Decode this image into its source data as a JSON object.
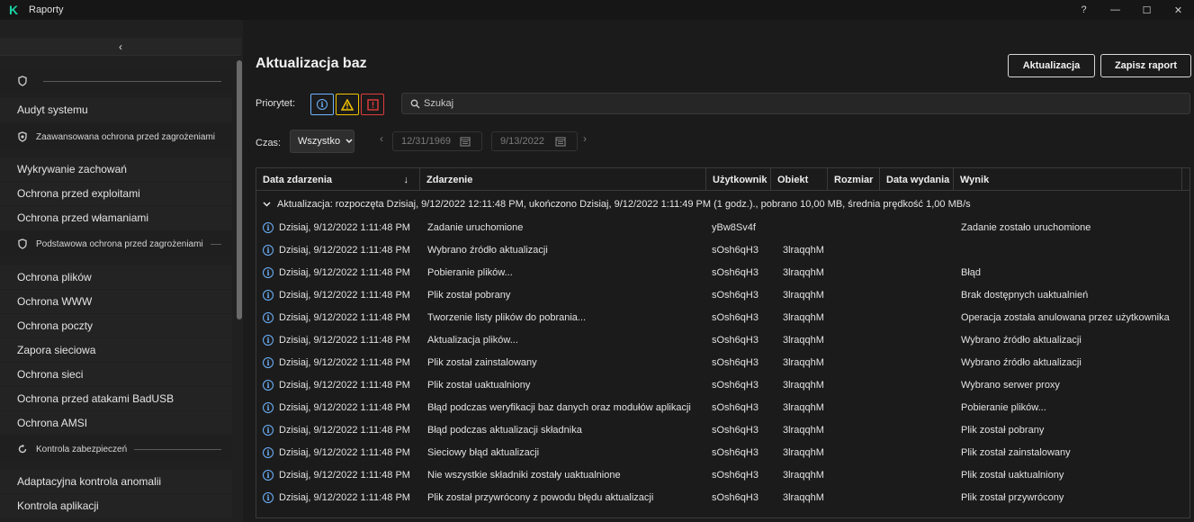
{
  "app": {
    "title": "Raporty",
    "logo": "K"
  },
  "window_controls": {
    "help": "?",
    "minimize": "—",
    "maximize": "☐",
    "close": "✕"
  },
  "sidebar": {
    "collapse": "‹",
    "items": [
      {
        "type": "header",
        "label": ""
      },
      {
        "type": "item",
        "label": "Audyt systemu"
      },
      {
        "type": "header",
        "label": "Zaawansowana ochrona przed zagrożeniami"
      },
      {
        "type": "item",
        "label": "Wykrywanie zachowań"
      },
      {
        "type": "item",
        "label": "Ochrona przed exploitami"
      },
      {
        "type": "item",
        "label": "Ochrona przed włamaniami"
      },
      {
        "type": "header",
        "label": "Podstawowa ochrona przed zagrożeniami"
      },
      {
        "type": "item",
        "label": "Ochrona plików"
      },
      {
        "type": "item",
        "label": "Ochrona WWW"
      },
      {
        "type": "item",
        "label": "Ochrona poczty"
      },
      {
        "type": "item",
        "label": "Zapora sieciowa"
      },
      {
        "type": "item",
        "label": "Ochrona sieci"
      },
      {
        "type": "item",
        "label": "Ochrona przed atakami BadUSB"
      },
      {
        "type": "item",
        "label": "Ochrona AMSI"
      },
      {
        "type": "header",
        "label": "Kontrola zabezpieczeń"
      },
      {
        "type": "item",
        "label": "Adaptacyjna kontrola anomalii"
      },
      {
        "type": "item",
        "label": "Kontrola aplikacji"
      }
    ]
  },
  "main": {
    "title": "Aktualizacja baz",
    "update_button": "Aktualizacja",
    "save_button": "Zapisz raport",
    "priority_label": "Priorytet:",
    "search_placeholder": "Szukaj",
    "time_label": "Czas:",
    "time_select": "Wszystko",
    "date_from": "12/31/1969",
    "date_to": "9/13/2022"
  },
  "table": {
    "columns": [
      "Data zdarzenia",
      "Zdarzenie",
      "Użytkownik",
      "Obiekt",
      "Rozmiar",
      "Data wydania",
      "Wynik"
    ],
    "sort_indicator": "↓",
    "group": "Aktualizacja: rozpoczęta Dzisiaj, 9/12/2022 12:11:48 PM, ukończono Dzisiaj, 9/12/2022 1:11:49 PM (1 godz.)., pobrano 10,00 MB, średnia prędkość 1,00 MB/s",
    "rows": [
      {
        "date": "Dzisiaj, 9/12/2022 1:11:48 PM",
        "event": "Zadanie uruchomione",
        "user": "yBw8Sv4f",
        "object": "",
        "result": "Zadanie zostało uruchomione"
      },
      {
        "date": "Dzisiaj, 9/12/2022 1:11:48 PM",
        "event": "Wybrano źródło aktualizacji",
        "user": "sOsh6qH3",
        "object": "3lraqqhM",
        "result": ""
      },
      {
        "date": "Dzisiaj, 9/12/2022 1:11:48 PM",
        "event": "Pobieranie plików...",
        "user": "sOsh6qH3",
        "object": "3lraqqhM",
        "result": "Błąd"
      },
      {
        "date": "Dzisiaj, 9/12/2022 1:11:48 PM",
        "event": "Plik został pobrany",
        "user": "sOsh6qH3",
        "object": "3lraqqhM",
        "result": "Brak dostępnych uaktualnień"
      },
      {
        "date": "Dzisiaj, 9/12/2022 1:11:48 PM",
        "event": "Tworzenie listy plików do pobrania...",
        "user": "sOsh6qH3",
        "object": "3lraqqhM",
        "result": "Operacja została anulowana przez użytkownika"
      },
      {
        "date": "Dzisiaj, 9/12/2022 1:11:48 PM",
        "event": "Aktualizacja plików...",
        "user": "sOsh6qH3",
        "object": "3lraqqhM",
        "result": "Wybrano źródło aktualizacji"
      },
      {
        "date": "Dzisiaj, 9/12/2022 1:11:48 PM",
        "event": "Plik został zainstalowany",
        "user": "sOsh6qH3",
        "object": "3lraqqhM",
        "result": "Wybrano źródło aktualizacji"
      },
      {
        "date": "Dzisiaj, 9/12/2022 1:11:48 PM",
        "event": "Plik został uaktualniony",
        "user": "sOsh6qH3",
        "object": "3lraqqhM",
        "result": "Wybrano serwer proxy"
      },
      {
        "date": "Dzisiaj, 9/12/2022 1:11:48 PM",
        "event": "Błąd podczas weryfikacji baz danych oraz modułów aplikacji",
        "user": "sOsh6qH3",
        "object": "3lraqqhM",
        "result": "Pobieranie plików..."
      },
      {
        "date": "Dzisiaj, 9/12/2022 1:11:48 PM",
        "event": "Błąd podczas aktualizacji składnika",
        "user": "sOsh6qH3",
        "object": "3lraqqhM",
        "result": "Plik został pobrany"
      },
      {
        "date": "Dzisiaj, 9/12/2022 1:11:48 PM",
        "event": "Sieciowy błąd aktualizacji",
        "user": "sOsh6qH3",
        "object": "3lraqqhM",
        "result": "Plik został zainstalowany"
      },
      {
        "date": "Dzisiaj, 9/12/2022 1:11:48 PM",
        "event": "Nie wszystkie składniki zostały uaktualnione",
        "user": "sOsh6qH3",
        "object": "3lraqqhM",
        "result": "Plik został uaktualniony"
      },
      {
        "date": "Dzisiaj, 9/12/2022 1:11:48 PM",
        "event": "Plik został przywrócony z powodu błędu aktualizacji",
        "user": "sOsh6qH3",
        "object": "3lraqqhM",
        "result": "Plik został przywrócony"
      }
    ]
  },
  "colors": {
    "accent": "#19d3a5",
    "info": "#6eb4ff",
    "warning": "#f2c200",
    "error": "#e03c3c"
  },
  "icons": {
    "info": "info-icon",
    "warning": "warning-icon",
    "error": "error-icon",
    "search": "search-icon",
    "calendar": "calendar-icon",
    "shield": "shield-icon",
    "chevron": "chevron-down-icon"
  }
}
